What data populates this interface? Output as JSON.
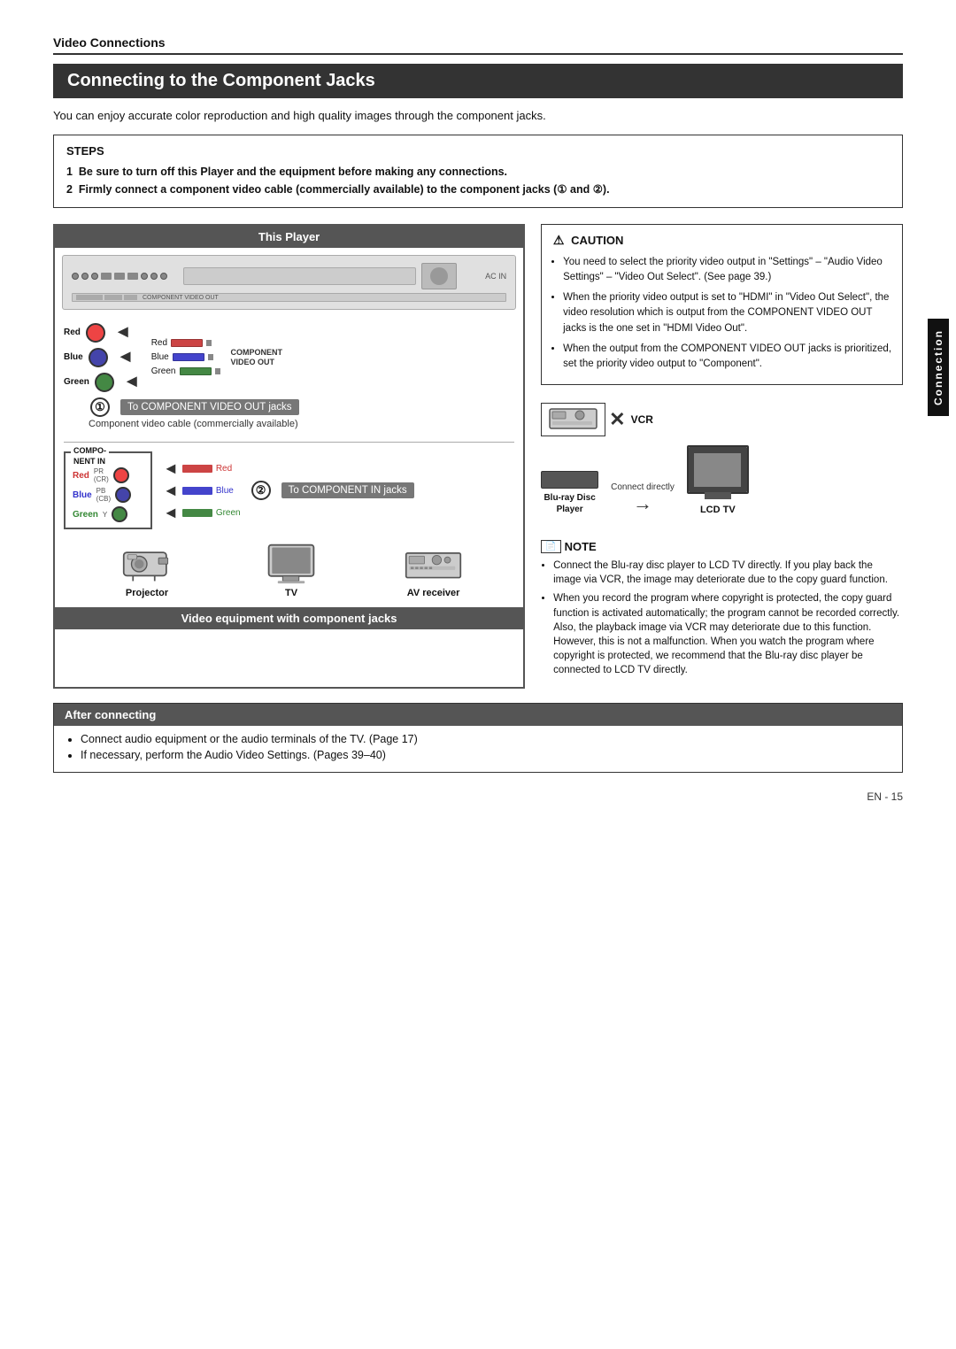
{
  "page": {
    "section_title": "Video Connections",
    "main_heading": "Connecting to the Component Jacks",
    "intro": "You can enjoy accurate color reproduction and high quality images through the component jacks.",
    "steps_label": "STEPS",
    "step1": "Be sure to turn off this Player and the equipment before making any connections.",
    "step2": "Firmly connect a component video cable (commercially available) to the component jacks (① and ②).",
    "this_player_label": "This Player",
    "step1_number": "①",
    "step2_number": "②",
    "step1_desc": "To COMPONENT VIDEO OUT jacks",
    "step2_desc": "To COMPONENT IN jacks",
    "cable_note": "Component video cable (commercially available)",
    "colors_red": "Red",
    "colors_blue": "Blue",
    "colors_green": "Green",
    "comp_nent_in_label": "COMPO-\nNENT IN",
    "comp_out_label": "COMPONENT\nVIDEO OUT",
    "caution_title": "CAUTION",
    "caution_items": [
      "You need to select the priority video output in \"Settings\" – \"Audio Video Settings\" – \"Video Out Select\". (See page 39.)",
      "When the priority video output is set to \"HDMI\" in \"Video Out Select\", the video resolution which is output from the COMPONENT VIDEO OUT jacks is the one set in \"HDMI Video Out\".",
      "When the output from the COMPONENT VIDEO OUT jacks is prioritized, set the priority video output to \"Component\"."
    ],
    "vcr_label": "VCR",
    "bluray_label": "Blu-ray Disc\nPlayer",
    "lcd_tv_label": "LCD TV",
    "connect_directly": "Connect directly",
    "note_title": "NOTE",
    "note_items": [
      "Connect the Blu-ray disc player to LCD TV directly. If you play back the image via VCR, the image may deteriorate due to the copy guard function.",
      "When you record the program where copyright is protected, the copy guard function is activated automatically; the program cannot be recorded correctly. Also, the playback image via VCR may deteriorate due to this function. However, this is not a malfunction. When you watch the program where copyright is protected, we recommend that the Blu-ray disc player be connected to LCD TV directly."
    ],
    "projector_label": "Projector",
    "tv_label": "TV",
    "av_receiver_label": "AV receiver",
    "video_equipment_label": "Video equipment with component jacks",
    "after_connecting_title": "After connecting",
    "after_connecting_items": [
      "Connect audio equipment or the audio terminals of the TV. (Page 17)",
      "If necessary, perform the Audio Video Settings. (Pages 39–40)"
    ],
    "connection_sidebar_label": "Connection",
    "page_number": "EN - 15"
  }
}
